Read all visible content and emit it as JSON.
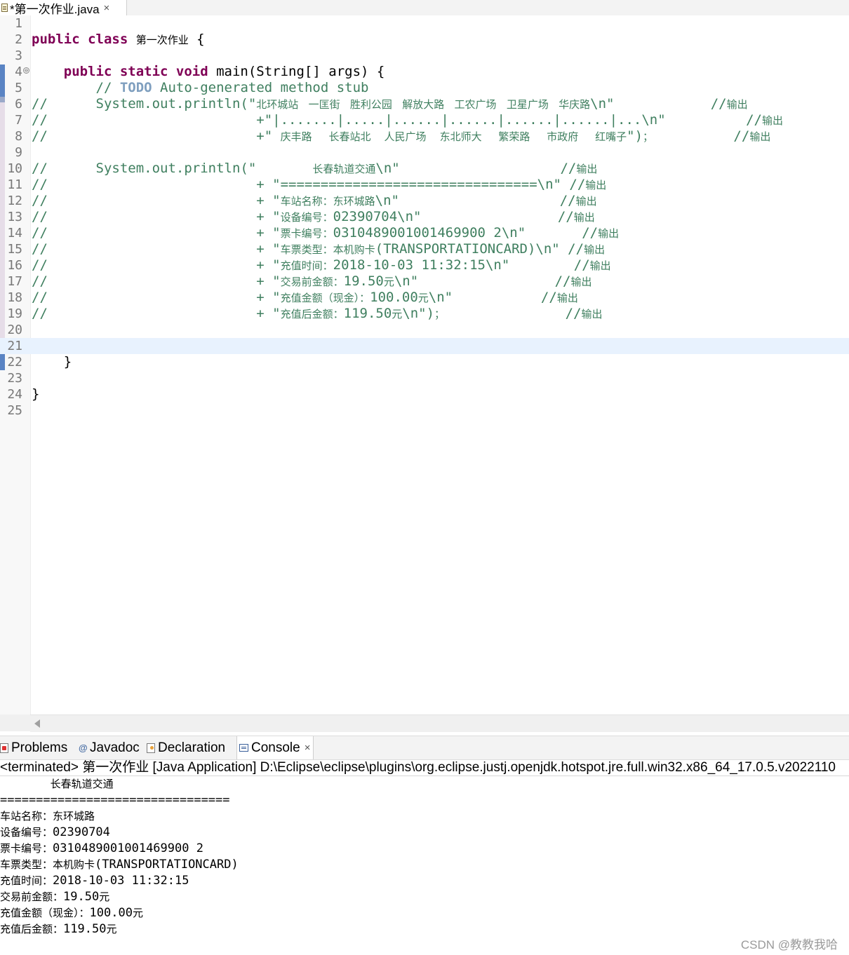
{
  "editor_tab": {
    "title": "*第一次作业.java",
    "close": "×"
  },
  "code_lines": [
    {
      "n": "1",
      "parts": []
    },
    {
      "n": "2",
      "parts": [
        {
          "c": "kw",
          "t": "public class "
        },
        {
          "c": "cj",
          "t": "第一次作业"
        },
        {
          "c": "",
          "t": " {"
        }
      ]
    },
    {
      "n": "3",
      "parts": []
    },
    {
      "n": "4",
      "fold": "⊖",
      "parts": [
        {
          "c": "",
          "t": "    "
        },
        {
          "c": "kw",
          "t": "public static void "
        },
        {
          "c": "",
          "t": "main(String[] args) {"
        }
      ]
    },
    {
      "n": "5",
      "parts": [
        {
          "c": "cm",
          "t": "        // "
        },
        {
          "c": "todo",
          "t": "TODO"
        },
        {
          "c": "cm",
          "t": " Auto-generated method stub"
        }
      ]
    },
    {
      "n": "6",
      "parts": [
        {
          "c": "cm",
          "t": "//      System.out.println(\""
        },
        {
          "c": "cm cj",
          "t": "北环城站   一匡街   胜利公园   解放大路   工农广场   卫星广场   华庆路"
        },
        {
          "c": "cm",
          "t": "\\n\"            //"
        },
        {
          "c": "cm cj",
          "t": "输出"
        }
      ]
    },
    {
      "n": "7",
      "parts": [
        {
          "c": "cm",
          "t": "//                          +\"|.......|.....|......|......|......|......|...\\n\"          //"
        },
        {
          "c": "cm cj",
          "t": "输出"
        }
      ]
    },
    {
      "n": "8",
      "parts": [
        {
          "c": "cm",
          "t": "//                          +\" "
        },
        {
          "c": "cm cj",
          "t": "庆丰路     长春站北    人民广场    东北师大     繁荣路     市政府     红嘴子"
        },
        {
          "c": "cm",
          "t": "\")"
        },
        {
          "c": "cm cj",
          "t": "；"
        },
        {
          "c": "cm",
          "t": "          //"
        },
        {
          "c": "cm cj",
          "t": "输出"
        }
      ]
    },
    {
      "n": "9",
      "parts": []
    },
    {
      "n": "10",
      "parts": [
        {
          "c": "cm",
          "t": "//      System.out.println(\"       "
        },
        {
          "c": "cm cj",
          "t": "长春轨道交通"
        },
        {
          "c": "cm",
          "t": "\\n\"                    //"
        },
        {
          "c": "cm cj",
          "t": "输出"
        }
      ]
    },
    {
      "n": "11",
      "parts": [
        {
          "c": "cm",
          "t": "//                          + \"================================\\n\" //"
        },
        {
          "c": "cm cj",
          "t": "输出"
        }
      ]
    },
    {
      "n": "12",
      "parts": [
        {
          "c": "cm",
          "t": "//                          + \""
        },
        {
          "c": "cm cj",
          "t": "车站名称："
        },
        {
          "c": "cm cj",
          "t": "东环城路"
        },
        {
          "c": "cm",
          "t": "\\n\"                    //"
        },
        {
          "c": "cm cj",
          "t": "输出"
        }
      ]
    },
    {
      "n": "13",
      "parts": [
        {
          "c": "cm",
          "t": "//                          + \""
        },
        {
          "c": "cm cj",
          "t": "设备编号："
        },
        {
          "c": "cm",
          "t": "02390704\\n\"                 //"
        },
        {
          "c": "cm cj",
          "t": "输出"
        }
      ]
    },
    {
      "n": "14",
      "parts": [
        {
          "c": "cm",
          "t": "//                          + \""
        },
        {
          "c": "cm cj",
          "t": "票卡编号："
        },
        {
          "c": "cm",
          "t": "0310489001001469900 2\\n\"       //"
        },
        {
          "c": "cm cj",
          "t": "输出"
        }
      ]
    },
    {
      "n": "15",
      "parts": [
        {
          "c": "cm",
          "t": "//                          + \""
        },
        {
          "c": "cm cj",
          "t": "车票类型："
        },
        {
          "c": "cm cj",
          "t": "本机购卡"
        },
        {
          "c": "cm",
          "t": "(TRANSPORTATIONCARD)\\n\" //"
        },
        {
          "c": "cm cj",
          "t": "输出"
        }
      ]
    },
    {
      "n": "16",
      "parts": [
        {
          "c": "cm",
          "t": "//                          + \""
        },
        {
          "c": "cm cj",
          "t": "充值时间："
        },
        {
          "c": "cm",
          "t": "2018-10-03 11:32:15\\n\"        //"
        },
        {
          "c": "cm cj",
          "t": "输出"
        }
      ]
    },
    {
      "n": "17",
      "parts": [
        {
          "c": "cm",
          "t": "//                          + \""
        },
        {
          "c": "cm cj",
          "t": "交易前金额："
        },
        {
          "c": "cm",
          "t": "19.50"
        },
        {
          "c": "cm cj",
          "t": "元"
        },
        {
          "c": "cm",
          "t": "\\n\"                 //"
        },
        {
          "c": "cm cj",
          "t": "输出"
        }
      ]
    },
    {
      "n": "18",
      "parts": [
        {
          "c": "cm",
          "t": "//                          + \""
        },
        {
          "c": "cm cj",
          "t": "充值金额（现金）："
        },
        {
          "c": "cm",
          "t": "100.00"
        },
        {
          "c": "cm cj",
          "t": "元"
        },
        {
          "c": "cm",
          "t": "\\n\"           //"
        },
        {
          "c": "cm cj",
          "t": "输出"
        }
      ]
    },
    {
      "n": "19",
      "parts": [
        {
          "c": "cm",
          "t": "//                          + \""
        },
        {
          "c": "cm cj",
          "t": "充值后金额："
        },
        {
          "c": "cm",
          "t": "119.50"
        },
        {
          "c": "cm cj",
          "t": "元"
        },
        {
          "c": "cm",
          "t": "\\n\")"
        },
        {
          "c": "cm cj",
          "t": "；"
        },
        {
          "c": "cm",
          "t": "               //"
        },
        {
          "c": "cm cj",
          "t": "输出"
        }
      ]
    },
    {
      "n": "20",
      "parts": []
    },
    {
      "n": "21",
      "current": true,
      "parts": []
    },
    {
      "n": "22",
      "parts": [
        {
          "c": "",
          "t": "    }"
        }
      ]
    },
    {
      "n": "23",
      "parts": []
    },
    {
      "n": "24",
      "parts": [
        {
          "c": "",
          "t": "}"
        }
      ]
    },
    {
      "n": "25",
      "parts": []
    }
  ],
  "view_tabs": [
    {
      "key": "problems",
      "label": "Problems"
    },
    {
      "key": "javadoc",
      "label": "Javadoc",
      "icon": "@"
    },
    {
      "key": "declaration",
      "label": "Declaration"
    },
    {
      "key": "console",
      "label": "Console",
      "close": "×"
    }
  ],
  "console": {
    "description": "<terminated> 第一次作业 [Java Application] D:\\Eclipse\\eclipse\\plugins\\org.eclipse.justj.openjdk.hotspot.jre.full.win32.x86_64_17.0.5.v2022110",
    "output": [
      [
        {
          "c": "",
          "t": "       "
        },
        {
          "c": "cj",
          "t": "长春轨道交通"
        }
      ],
      [
        {
          "c": "",
          "t": "================================"
        }
      ],
      [
        {
          "c": "cj",
          "t": "车站名称：东环城路"
        }
      ],
      [
        {
          "c": "cj",
          "t": "设备编号："
        },
        {
          "c": "",
          "t": "02390704"
        }
      ],
      [
        {
          "c": "cj",
          "t": "票卡编号："
        },
        {
          "c": "",
          "t": "0310489001001469900 2"
        }
      ],
      [
        {
          "c": "cj",
          "t": "车票类型：本机购卡"
        },
        {
          "c": "",
          "t": "(TRANSPORTATIONCARD)"
        }
      ],
      [
        {
          "c": "cj",
          "t": "充值时间："
        },
        {
          "c": "",
          "t": "2018-10-03 11:32:15"
        }
      ],
      [
        {
          "c": "cj",
          "t": "交易前金额："
        },
        {
          "c": "",
          "t": "19.50"
        },
        {
          "c": "cj",
          "t": "元"
        }
      ],
      [
        {
          "c": "cj",
          "t": "充值金额（现金）："
        },
        {
          "c": "",
          "t": "100.00"
        },
        {
          "c": "cj",
          "t": "元"
        }
      ],
      [
        {
          "c": "cj",
          "t": "充值后金额："
        },
        {
          "c": "",
          "t": "119.50"
        },
        {
          "c": "cj",
          "t": "元"
        }
      ]
    ]
  },
  "watermark": "CSDN @教教我哈"
}
